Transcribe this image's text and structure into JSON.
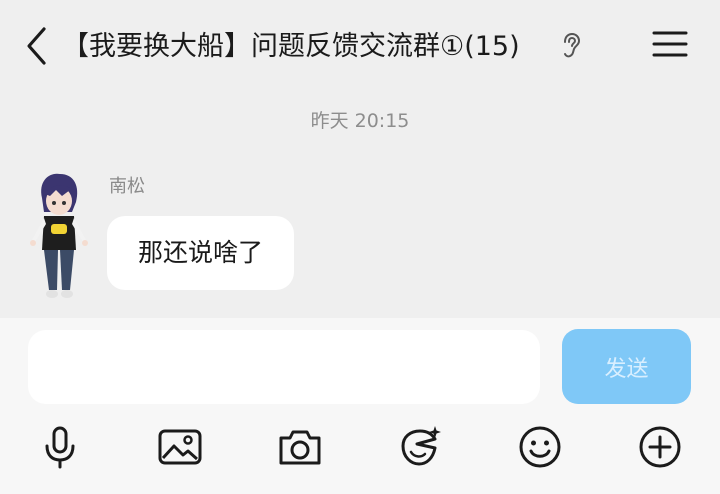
{
  "header": {
    "back_icon": "chevron-left-icon",
    "title": "【我要换大船】问题反馈交流群①(15)",
    "ear_icon": "ear-icon",
    "menu_icon": "menu-icon"
  },
  "chat": {
    "timestamp": "昨天 20:15",
    "messages": [
      {
        "sender": "南松",
        "text": "那还说啥了",
        "avatar_icon": "anime-avatar"
      }
    ]
  },
  "composer": {
    "input_value": "",
    "send_label": "发送",
    "send_color": "#7fc8f7"
  },
  "toolbar": {
    "icons": [
      "microphone-icon",
      "image-icon",
      "camera-icon",
      "sticker-icon",
      "emoji-icon",
      "plus-icon"
    ]
  }
}
